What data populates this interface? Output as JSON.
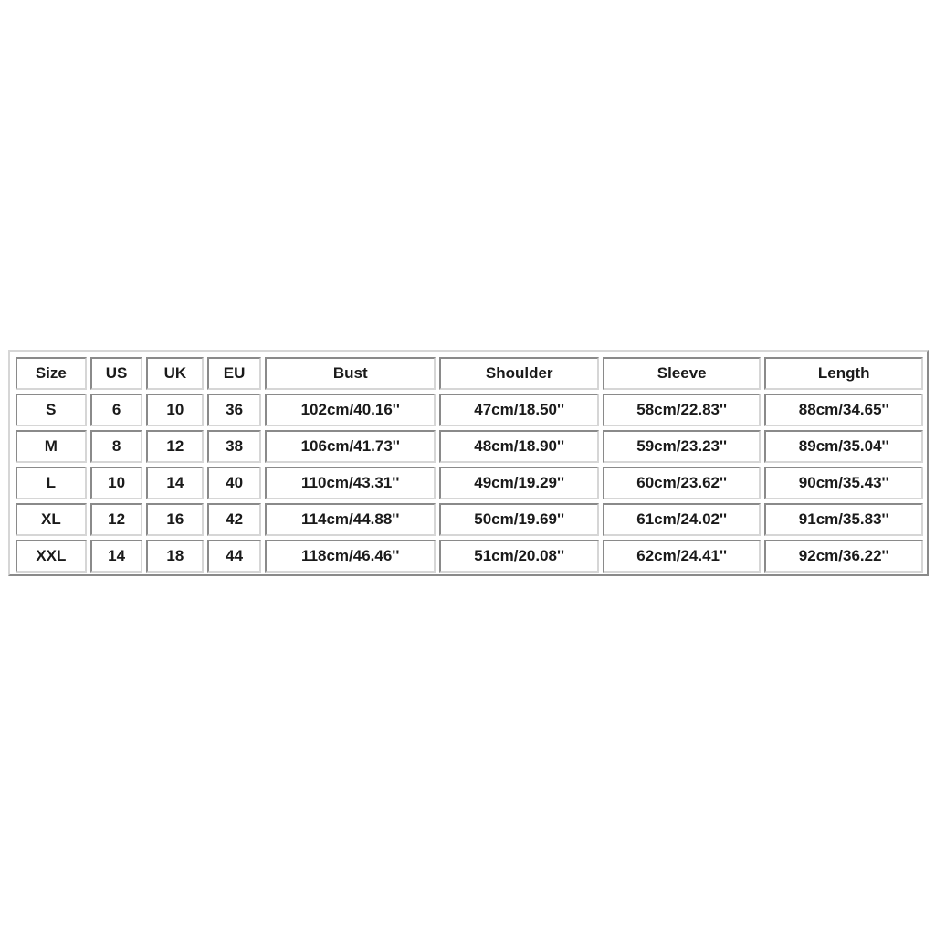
{
  "size_chart": {
    "headers": [
      "Size",
      "US",
      "UK",
      "EU",
      "Bust",
      "Shoulder",
      "Sleeve",
      "Length"
    ],
    "rows": [
      [
        "S",
        "6",
        "10",
        "36",
        "102cm/40.16''",
        "47cm/18.50''",
        "58cm/22.83''",
        "88cm/34.65''"
      ],
      [
        "M",
        "8",
        "12",
        "38",
        "106cm/41.73''",
        "48cm/18.90''",
        "59cm/23.23''",
        "89cm/35.04''"
      ],
      [
        "L",
        "10",
        "14",
        "40",
        "110cm/43.31''",
        "49cm/19.29''",
        "60cm/23.62''",
        "90cm/35.43''"
      ],
      [
        "XL",
        "12",
        "16",
        "42",
        "114cm/44.88''",
        "50cm/19.69''",
        "61cm/24.02''",
        "91cm/35.83''"
      ],
      [
        "XXL",
        "14",
        "18",
        "44",
        "118cm/46.46''",
        "51cm/20.08''",
        "62cm/24.41''",
        "92cm/36.22''"
      ]
    ]
  }
}
